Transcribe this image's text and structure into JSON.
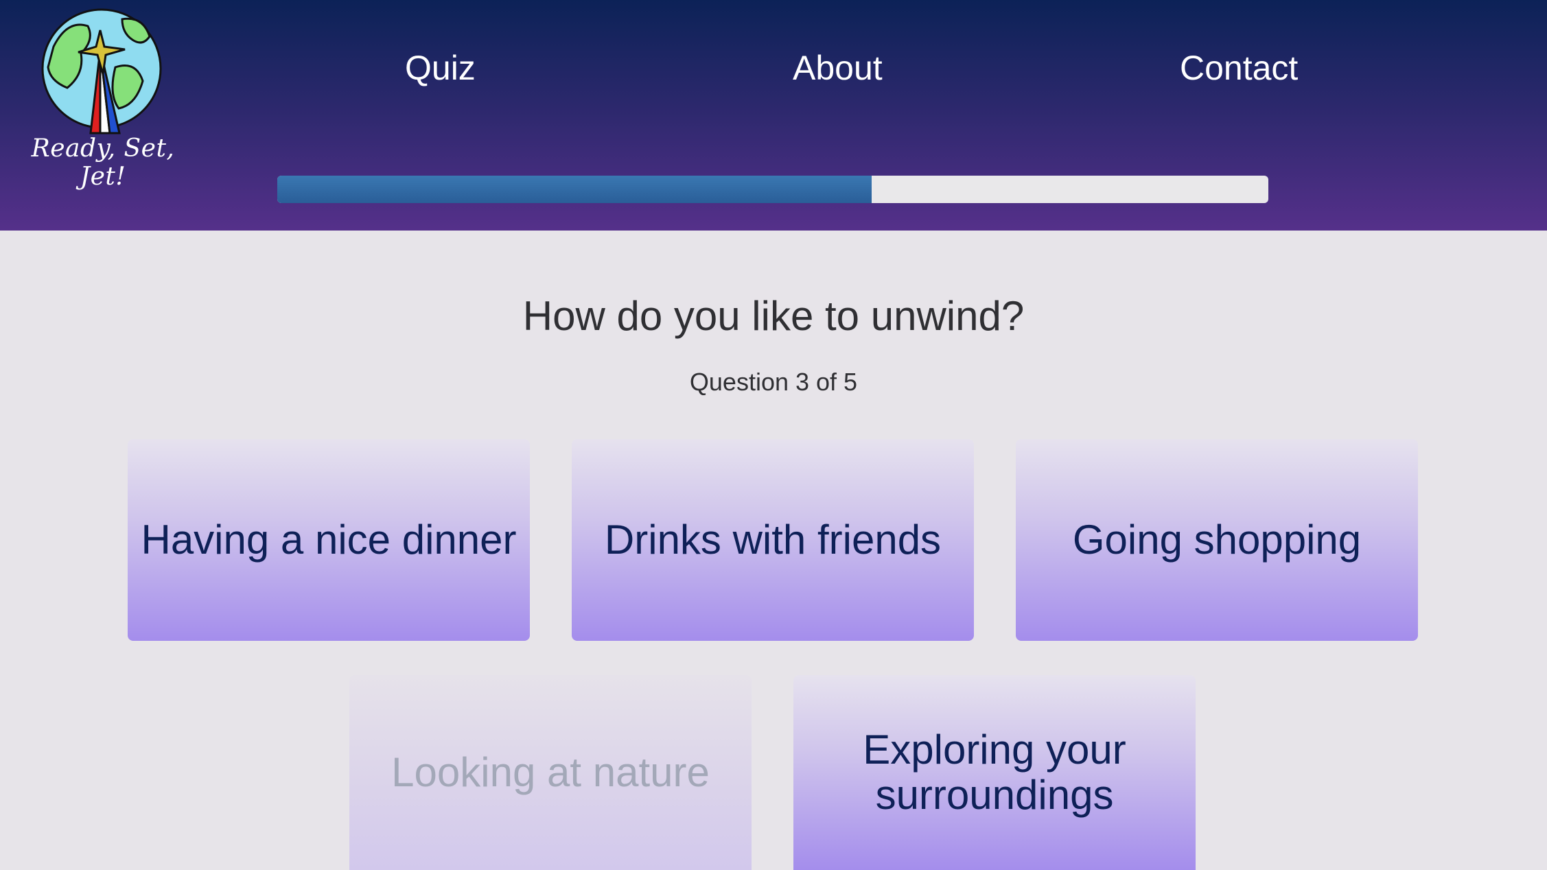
{
  "brand": {
    "logo_text": "Ready, Set, Jet!",
    "icon": "globe-rocket-icon"
  },
  "nav": {
    "items": [
      {
        "label": "Quiz"
      },
      {
        "label": "About"
      },
      {
        "label": "Contact"
      }
    ]
  },
  "progress": {
    "fraction": 0.6
  },
  "quiz": {
    "question": "How do you like to unwind?",
    "counter": "Question 3 of 5",
    "options": [
      {
        "label": "Having a nice dinner"
      },
      {
        "label": "Drinks with friends"
      },
      {
        "label": "Going shopping"
      },
      {
        "label": "Looking at nature"
      },
      {
        "label": "Exploring your surroundings"
      }
    ]
  },
  "colors": {
    "header_top": "#0c2257",
    "header_bottom": "#55308a",
    "progress_fill": "#2f6aa6",
    "option_text": "#0e2057",
    "option_faded_text": "#a3a8b8"
  }
}
